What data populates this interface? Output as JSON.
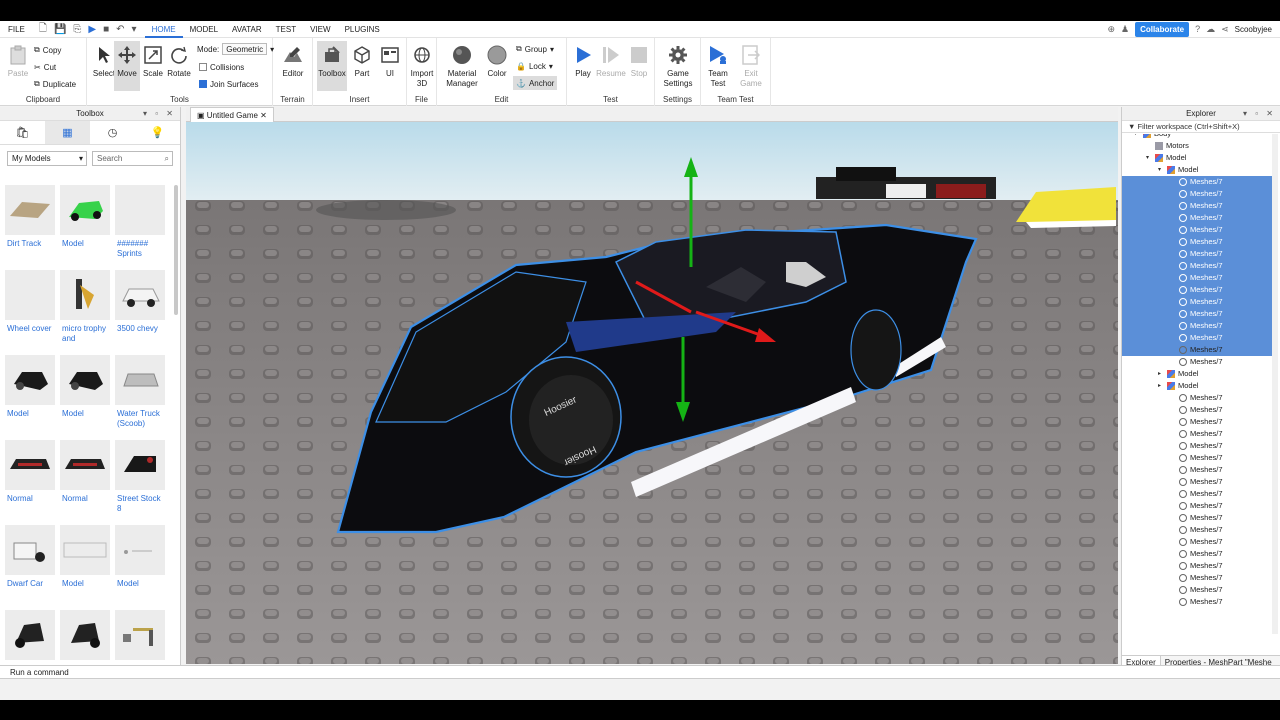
{
  "menubar": {
    "file": "FILE",
    "tabs": [
      "HOME",
      "MODEL",
      "AVATAR",
      "TEST",
      "VIEW",
      "PLUGINS"
    ],
    "collaborate": "Collaborate",
    "user": "Scoobyjee"
  },
  "ribbon": {
    "clipboard": {
      "paste": "Paste",
      "copy": "Copy",
      "cut": "Cut",
      "duplicate": "Duplicate",
      "label": "Clipboard"
    },
    "tools": {
      "select": "Select",
      "move": "Move",
      "scale": "Scale",
      "rotate": "Rotate",
      "mode_label": "Mode:",
      "mode_value": "Geometric",
      "collisions": "Collisions",
      "join_surfaces": "Join Surfaces",
      "label": "Tools"
    },
    "terrain": {
      "editor": "Editor",
      "label": "Terrain"
    },
    "insert": {
      "toolbox": "Toolbox",
      "part": "Part",
      "ui": "UI",
      "label": "Insert"
    },
    "file": {
      "import_a": "Import",
      "import_b": "3D",
      "label": "File"
    },
    "edit": {
      "material_a": "Material",
      "material_b": "Manager",
      "color": "Color",
      "group": "Group",
      "lock": "Lock",
      "anchor": "Anchor",
      "label": "Edit"
    },
    "test": {
      "play": "Play",
      "resume": "Resume",
      "stop": "Stop",
      "label": "Test"
    },
    "settings": {
      "game_a": "Game",
      "game_b": "Settings",
      "label": "Settings"
    },
    "team_test": {
      "team_a": "Team",
      "team_b": "Test",
      "exit_a": "Exit",
      "exit_b": "Game",
      "label": "Team Test"
    }
  },
  "toolbox": {
    "title": "Toolbox",
    "filter": "My Models",
    "search_placeholder": "Search",
    "items": [
      {
        "name": "Dirt Track"
      },
      {
        "name": "Model"
      },
      {
        "name": "####### Sprints"
      },
      {
        "name": "Wheel cover"
      },
      {
        "name": "micro trophy and"
      },
      {
        "name": "3500 chevy"
      },
      {
        "name": "Model"
      },
      {
        "name": "Model"
      },
      {
        "name": "Water Truck (Scoob)"
      },
      {
        "name": "Normal"
      },
      {
        "name": "Normal"
      },
      {
        "name": "Street Stock 8"
      },
      {
        "name": "Dwarf Car"
      },
      {
        "name": "Model"
      },
      {
        "name": "Model"
      },
      {
        "name": ""
      },
      {
        "name": ""
      },
      {
        "name": ""
      }
    ]
  },
  "document": {
    "tab": "Untitled Game"
  },
  "viewport": {
    "tire_text_a": "Hoosier",
    "tire_text_b": "Hoosier"
  },
  "explorer": {
    "title": "Explorer",
    "filter_placeholder": "Filter workspace (Ctrl+Shift+X)",
    "nodes": [
      {
        "label": "Body"
      },
      {
        "label": "Motors"
      },
      {
        "label": "Model"
      },
      {
        "label": "Model"
      },
      {
        "label": "Meshes/7"
      },
      {
        "label": "Meshes/7"
      },
      {
        "label": "Meshes/7"
      },
      {
        "label": "Meshes/7"
      },
      {
        "label": "Meshes/7"
      },
      {
        "label": "Meshes/7"
      },
      {
        "label": "Meshes/7"
      },
      {
        "label": "Meshes/7"
      },
      {
        "label": "Meshes/7"
      },
      {
        "label": "Meshes/7"
      },
      {
        "label": "Meshes/7"
      },
      {
        "label": "Meshes/7"
      },
      {
        "label": "Meshes/7"
      },
      {
        "label": "Meshes/7"
      },
      {
        "label": "Meshes/7"
      },
      {
        "label": "Meshes/7"
      },
      {
        "label": "Model"
      },
      {
        "label": "Model"
      },
      {
        "label": "Meshes/7"
      },
      {
        "label": "Meshes/7"
      },
      {
        "label": "Meshes/7"
      },
      {
        "label": "Meshes/7"
      },
      {
        "label": "Meshes/7"
      },
      {
        "label": "Meshes/7"
      },
      {
        "label": "Meshes/7"
      },
      {
        "label": "Meshes/7"
      },
      {
        "label": "Meshes/7"
      },
      {
        "label": "Meshes/7"
      },
      {
        "label": "Meshes/7"
      },
      {
        "label": "Meshes/7"
      },
      {
        "label": "Meshes/7"
      },
      {
        "label": "Meshes/7"
      },
      {
        "label": "Meshes/7"
      },
      {
        "label": "Meshes/7"
      },
      {
        "label": "Meshes/7"
      },
      {
        "label": "Meshes/7"
      }
    ],
    "tab_explorer": "Explorer",
    "tab_properties": "Properties - MeshPart \"Meshe"
  },
  "command_bar": {
    "placeholder": "Run a command"
  },
  "colors": {
    "accent": "#2b6fd6",
    "selection": "#5b8fd8",
    "collaborate": "#2b84e9"
  }
}
